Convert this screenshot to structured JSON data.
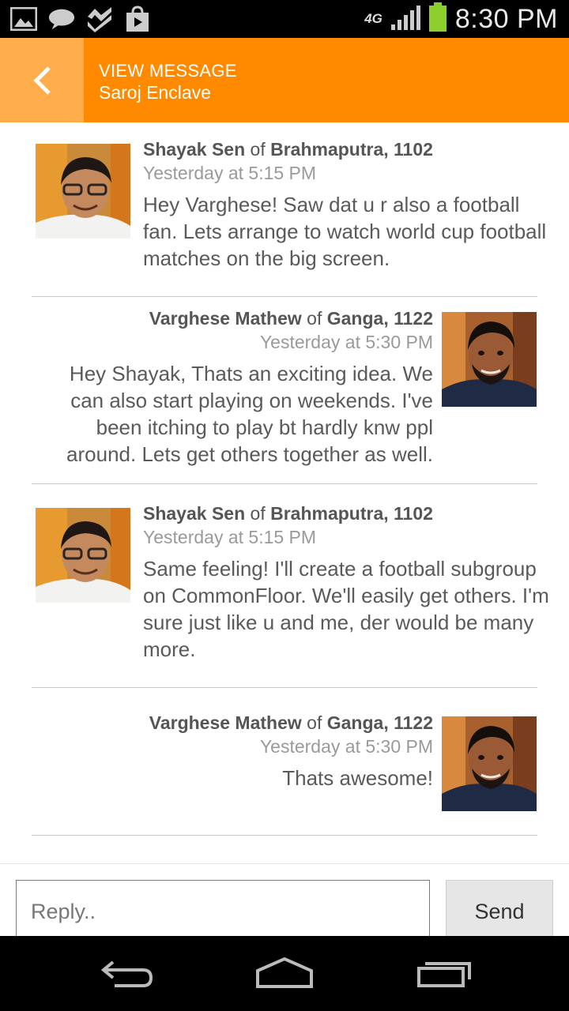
{
  "status_bar": {
    "time": "8:30 PM",
    "network": "4G",
    "icons": [
      "gallery-icon",
      "chat-bubble-icon",
      "dropbox-icon",
      "shopping-bag-icon"
    ],
    "battery_color": "#8ccf2c"
  },
  "action_bar": {
    "title": "VIEW MESSAGE",
    "subtitle": "Saroj Enclave",
    "color": "#ff8a00",
    "back_button_color": "#ffad4a"
  },
  "messages": [
    {
      "name": "Shayak Sen",
      "of": "of",
      "location": "Brahmaputra, 1102",
      "time": "Yesterday at 5:15 PM",
      "text": "Hey Varghese! Saw dat u r also a football fan. Lets arrange to watch world cup football matches on the big screen.",
      "align": "left"
    },
    {
      "name": "Varghese Mathew",
      "of": "of",
      "location": "Ganga, 1122",
      "time": "Yesterday at 5:30 PM",
      "text": "Hey Shayak, Thats an exciting idea. We can also start playing on weekends. I've been itching to play bt hardly knw ppl around. Lets get others together as well.",
      "align": "right"
    },
    {
      "name": "Shayak Sen",
      "of": "of",
      "location": "Brahmaputra, 1102",
      "time": "Yesterday at 5:15 PM",
      "text": "Same feeling! I'll create a football subgroup on CommonFloor. We'll easily get others. I'm sure just like u and me, der would be many more.",
      "align": "left"
    },
    {
      "name": "Varghese Mathew",
      "of": "of",
      "location": "Ganga, 1122",
      "time": "Yesterday at 5:30 PM",
      "text": "Thats awesome!",
      "align": "right"
    }
  ],
  "reply": {
    "placeholder": "Reply..",
    "send_label": "Send"
  },
  "nav_bar": {
    "buttons": [
      "back-icon",
      "home-icon",
      "recent-apps-icon"
    ]
  }
}
